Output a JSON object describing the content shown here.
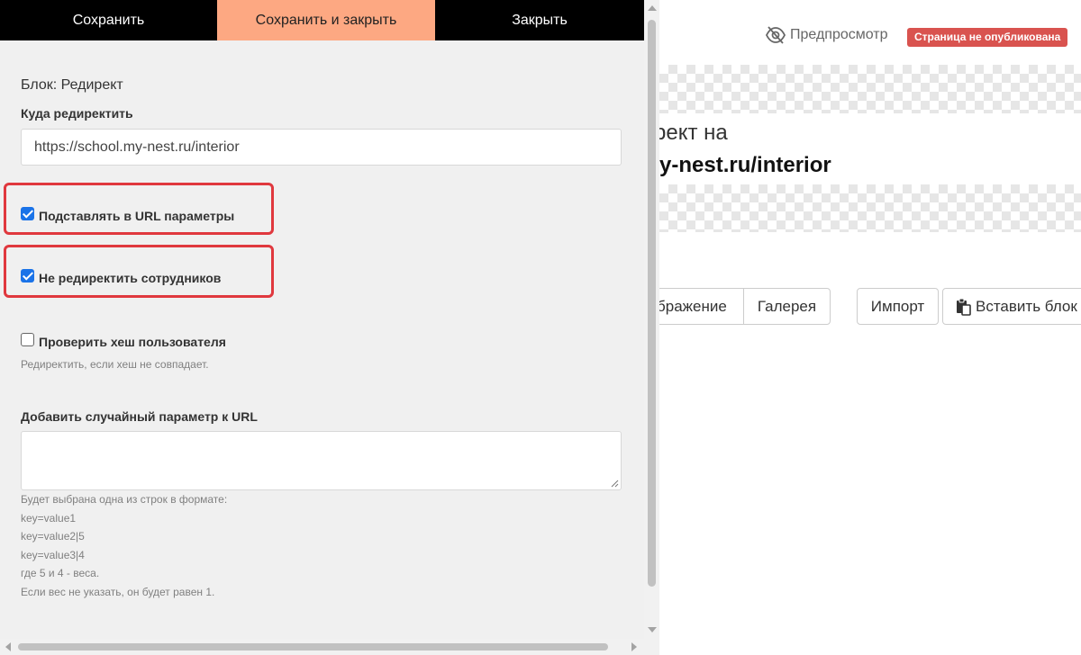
{
  "toolbar": {
    "save": "Сохранить",
    "save_close": "Сохранить и закрыть",
    "close": "Закрыть"
  },
  "editor": {
    "block_title": "Блок: Редирект",
    "redirect_to_label": "Куда редиректить",
    "redirect_url_value": "https://school.my-nest.ru/interior",
    "pass_url_params_label": "Подставлять в URL параметры",
    "pass_url_params_checked": true,
    "skip_staff_label": "Не редиректить сотрудников",
    "skip_staff_checked": true,
    "check_hash_label": "Проверить хеш пользователя",
    "check_hash_checked": false,
    "check_hash_hint": "Редиректить, если хеш не совпадает.",
    "random_param_label": "Добавить случайный параметр к URL",
    "random_param_value": "",
    "random_param_hint": [
      "Будет выбрана одна из строк в формате:",
      "key=value1",
      "key=value2|5",
      "key=value3|4",
      "где 5 и 4 - веса.",
      "Если вес не указать, он будет равен 1."
    ]
  },
  "preview": {
    "toggle_label": "Предпросмотр",
    "status_badge": "Страница не опубликована",
    "redirect_text_line1": "рект на",
    "redirect_text_line2": "y-nest.ru/interior",
    "buttons": {
      "image": "бражение",
      "gallery": "Галерея",
      "import": "Импорт",
      "paste_block": "Вставить блок"
    }
  },
  "colors": {
    "accent_save_close": "#fda882",
    "highlight_border": "#e0383e",
    "badge_bg": "#d9534f",
    "checkbox_checked": "#1a73e8"
  },
  "icons": {
    "preview_toggle": "eye-slash-icon",
    "paste_block": "clipboard-icon"
  }
}
